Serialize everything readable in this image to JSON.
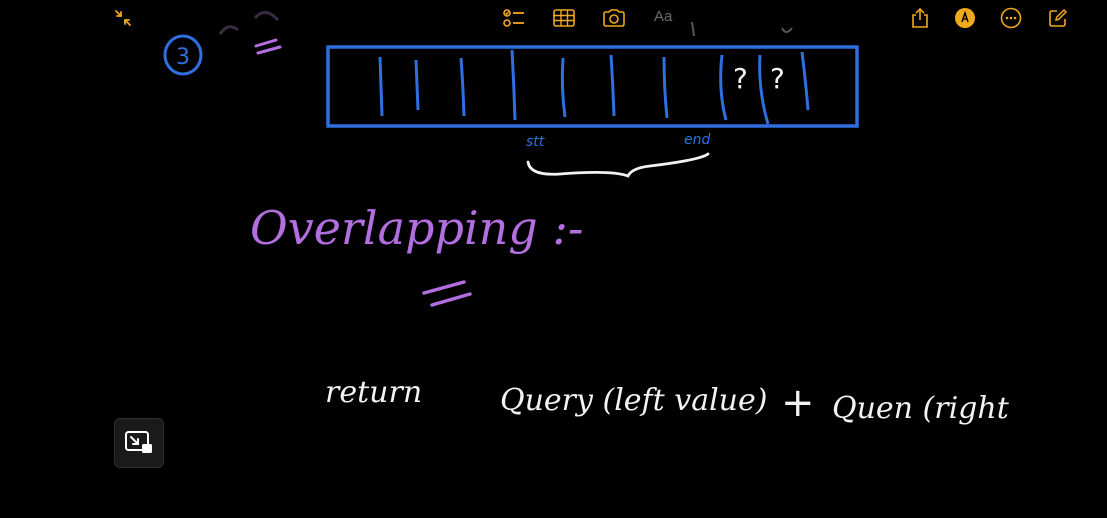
{
  "toolbar": {
    "font_label": "Aa",
    "icons": {
      "collapse": "collapse-arrows-icon",
      "checklist": "checklist-icon",
      "table": "table-icon",
      "camera": "camera-icon",
      "share": "share-icon",
      "markup": "markup-pen-icon",
      "more": "more-ellipsis-icon",
      "compose": "compose-icon"
    },
    "accent_color": "#f0a81e",
    "muted_color": "#6b6b6b"
  },
  "note": {
    "step_number": "3",
    "array_marks": [
      "?",
      "?"
    ],
    "start_label": "stt",
    "end_label": "end",
    "heading": "Overlapping :-",
    "code_return": "return",
    "code_call_left": "Query (left value)",
    "code_plus": "+",
    "code_call_right": "Quen (right",
    "colors": {
      "blue": "#2f6fe0",
      "purple": "#b36ee0",
      "white": "#f2f2f2"
    }
  },
  "pip": {
    "icon": "picture-in-picture-icon"
  }
}
